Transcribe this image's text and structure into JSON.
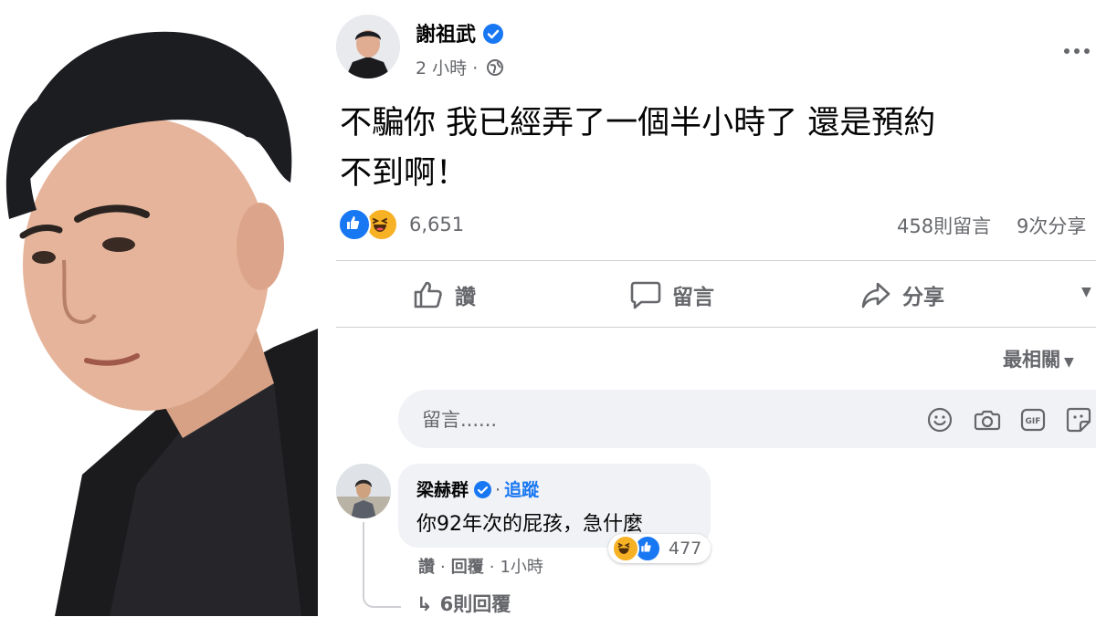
{
  "post": {
    "author": "謝祖武",
    "time": "2 小時",
    "time_separator": "·",
    "more_icon": "more-horizontal-icon",
    "text_line1": "不騙你 我已經弄了一個半小時了 還是預約",
    "text_line2": "不到啊！",
    "reaction_count": "6,651",
    "comments_count": "458則留言",
    "shares_count": "9次分享"
  },
  "actions": {
    "like": "讚",
    "comment": "留言",
    "share": "分享"
  },
  "sort_label": "最相關",
  "comment_box": {
    "placeholder": "留言......"
  },
  "comment": {
    "name": "梁赫群",
    "separator": "·",
    "follow": "追蹤",
    "text": "你92年次的屁孩，急什麼",
    "reaction_count": "477",
    "like": "讚",
    "reply": "回覆",
    "time": "1小時",
    "dot": "·",
    "replies_label": "6則回覆"
  },
  "colors": {
    "facebook_blue": "#1877f2",
    "haha_yellow": "#f7b125",
    "secondary_text": "#65676b",
    "comment_bg": "#f0f2f5"
  }
}
